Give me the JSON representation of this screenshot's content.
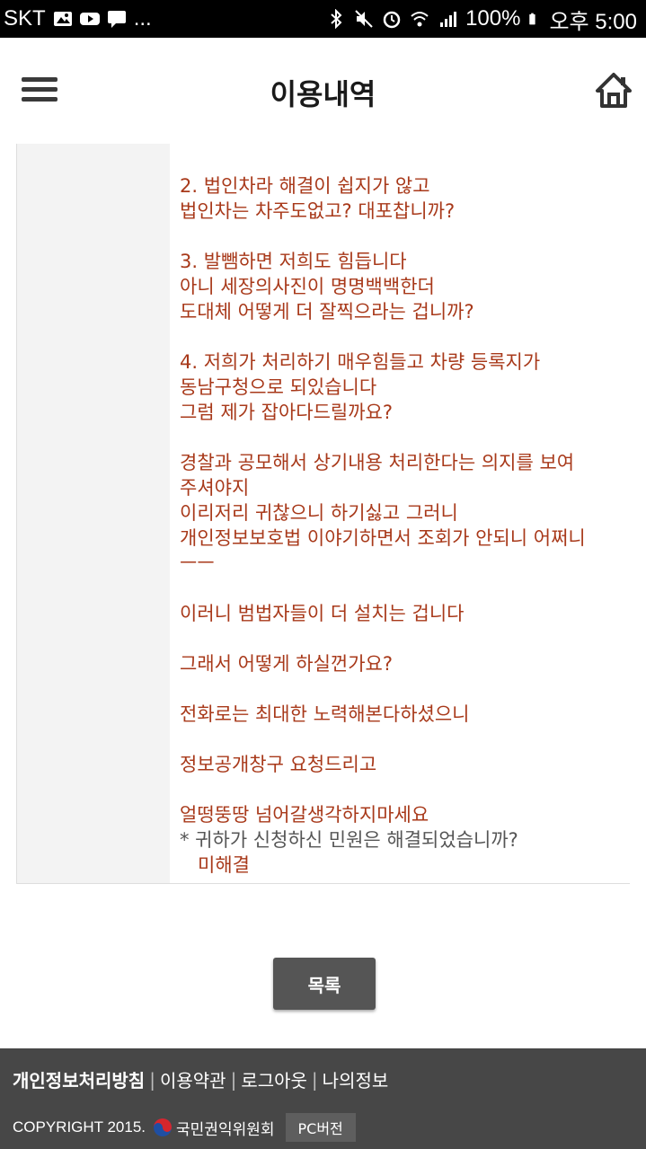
{
  "status_bar": {
    "carrier": "SKT",
    "battery": "100%",
    "time": "오후 5:00",
    "more": "..."
  },
  "header": {
    "title": "이용내역",
    "menu_icon": "hamburger-menu-icon",
    "home_icon": "home-icon"
  },
  "content": {
    "answer_lines": [
      "2. 법인차라 해결이 쉽지가 않고",
      "법인차는 차주도없고? 대포찹니까?",
      "3. 발뺌하면 저희도 힘듭니다",
      "아니 세장의사진이 명명백백한더",
      "도대체 어떻게 더 잘찍으라는 겁니까?",
      "4. 저희가 처리하기 매우힘들고 차량 등록지가",
      "동남구청으로 되있습니다",
      "그럼 제가 잡아다드릴까요?",
      "경찰과 공모해서 상기내용 처리한다는 의지를 보여",
      "주셔야지",
      "이리저리 귀찮으니 하기싫고 그러니",
      "개인정보보호법 이야기하면서 조회가 안되니 어쩌니",
      "ㅡㅡ",
      "이러니 범법자들이 더 설치는 겁니다",
      "그래서 어떻게 하실껀가요?",
      "전화로는 최대한 노력해본다하셨으니",
      "정보공개창구 요청드리고",
      "얼떵뚱땅 넘어갈생각하지마세요"
    ],
    "resolved_question": "* 귀하가 신청하신 민원은 해결되었습니까?",
    "resolved_answer": "미해결"
  },
  "list_button": "목록",
  "footer": {
    "links": [
      "개인정보처리방침",
      "이용약관",
      "로그아웃",
      "나의정보"
    ],
    "separator": "|",
    "copyright": "COPYRIGHT 2015.",
    "agency": "국민권익위원회",
    "pc_version": "PC버전"
  },
  "colors": {
    "answer_text": "#a8391a",
    "footer_bg": "#474747",
    "button_bg": "#555555"
  }
}
